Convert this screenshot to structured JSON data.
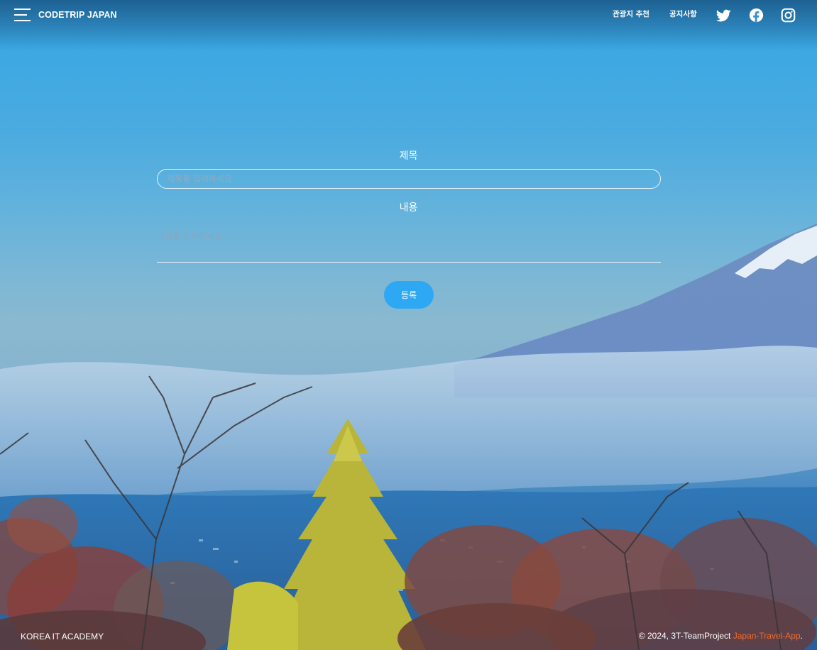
{
  "header": {
    "brand": "CODETRIP JAPAN",
    "nav": {
      "recommend": "관광지 추천",
      "notice": "공지사항"
    },
    "social": [
      "twitter-icon",
      "facebook-icon",
      "instagram-icon"
    ]
  },
  "form": {
    "title_label": "제목",
    "title_placeholder": "제목을 입력하세요",
    "content_label": "내용",
    "content_placeholder": "내용을 입력하세요",
    "submit_label": "등록"
  },
  "footer": {
    "left": "KOREA IT ACADEMY",
    "copyright": "© 2024, 3T-TeamProject ",
    "project_link": "Japan-Travel-App",
    "period": "."
  },
  "colors": {
    "accent_button": "#2ea8f2",
    "footer_link": "#f26b2a",
    "text": "#ffffff"
  }
}
